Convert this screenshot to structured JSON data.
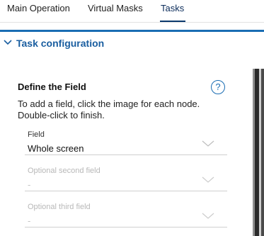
{
  "tabs": {
    "main_operation": "Main Operation",
    "virtual_masks": "Virtual Masks",
    "tasks": "Tasks"
  },
  "section": {
    "title": "Task configuration"
  },
  "define_field": {
    "title": "Define the Field",
    "help": "?",
    "instruction_line1": "To add a field, click the image for each node.",
    "instruction_line2": "Double-click to finish."
  },
  "fields": {
    "field": {
      "label": "Field",
      "value": "Whole screen"
    },
    "second": {
      "label": "Optional second field",
      "value": "-"
    },
    "third": {
      "label": "Optional third field",
      "value": "-"
    }
  },
  "colors": {
    "accent": "#1a6db3",
    "section_title": "#1a5ea0",
    "active_tab_underline": "#0b3a6e"
  },
  "icons": {
    "section_toggle": "chevron-down-icon",
    "help": "help-circle-icon",
    "dropdown": "chevron-down-icon"
  }
}
